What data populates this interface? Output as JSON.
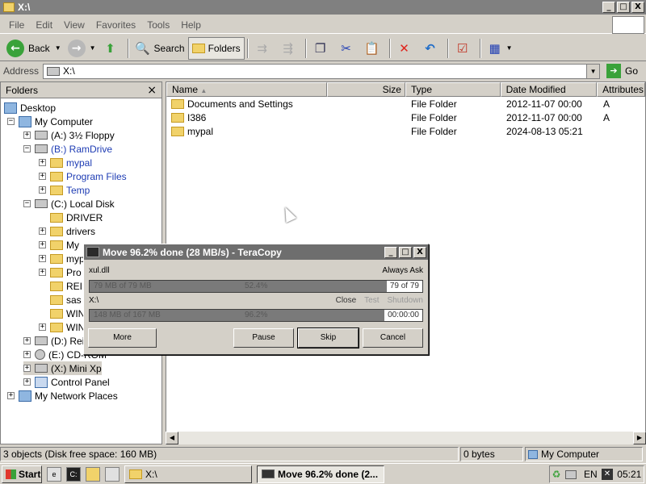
{
  "window": {
    "title": "X:\\",
    "buttons": {
      "minimize": "_",
      "maximize": "□",
      "close": "X"
    }
  },
  "menu": [
    "File",
    "Edit",
    "View",
    "Favorites",
    "Tools",
    "Help"
  ],
  "toolbar": {
    "back": "Back",
    "search": "Search",
    "folders": "Folders"
  },
  "address": {
    "label": "Address",
    "value": "X:\\",
    "go": "Go"
  },
  "folders_pane": {
    "title": "Folders",
    "close": "×",
    "items": [
      {
        "label": "Desktop"
      },
      {
        "label": "My Computer"
      },
      {
        "label": "(A:) 3½ Floppy"
      },
      {
        "label": "(B:) RamDrive"
      },
      {
        "label": "mypal"
      },
      {
        "label": "Program Files"
      },
      {
        "label": "Temp"
      },
      {
        "label": "(C:) Local Disk"
      },
      {
        "label": "DRIVER"
      },
      {
        "label": "drivers"
      },
      {
        "label": "My"
      },
      {
        "label": "myp"
      },
      {
        "label": "Pro"
      },
      {
        "label": "REI"
      },
      {
        "label": "sas"
      },
      {
        "label": "WIN"
      },
      {
        "label": "WIN"
      },
      {
        "label": "(D:) Rei"
      },
      {
        "label": "(E:) CD-ROM"
      },
      {
        "label": "(X:) Mini Xp"
      },
      {
        "label": "Control Panel"
      },
      {
        "label": "My Network Places"
      }
    ]
  },
  "file_list": {
    "columns": [
      "Name",
      "Size",
      "Type",
      "Date Modified",
      "Attributes"
    ],
    "rows": [
      {
        "name": "Documents and Settings",
        "size": "",
        "type": "File Folder",
        "date": "2012-11-07 00:00",
        "attr": "A"
      },
      {
        "name": "I386",
        "size": "",
        "type": "File Folder",
        "date": "2012-11-07 00:00",
        "attr": "A"
      },
      {
        "name": "mypal",
        "size": "",
        "type": "File Folder",
        "date": "2024-08-13 05:21",
        "attr": ""
      }
    ]
  },
  "statusbar": {
    "objects": "3 objects (Disk free space: 160 MB)",
    "size": "0 bytes",
    "location": "My Computer"
  },
  "teracopy": {
    "title": "Move 96.2% done (28 MB/s) - TeraCopy",
    "current_file": "xul.dll",
    "always_ask": "Always Ask",
    "file_progress": {
      "text": "79 MB of 79 MB",
      "percent": "52.4%",
      "count": "79 of 79",
      "fraction": 0.92
    },
    "target": "X:\\",
    "options": {
      "close": "Close",
      "test": "Test",
      "shutdown": "Shutdown"
    },
    "total_progress": {
      "text": "148 MB of 167 MB",
      "percent": "96.2%",
      "time": "00:00:00",
      "fraction": 0.962
    },
    "buttons": {
      "more": "More",
      "pause": "Pause",
      "skip": "Skip",
      "cancel": "Cancel"
    }
  },
  "taskbar": {
    "start": "Start",
    "tasks": [
      "X:\\",
      "Move 96.2% done (2..."
    ],
    "lang": "EN",
    "clock": "05:21"
  }
}
